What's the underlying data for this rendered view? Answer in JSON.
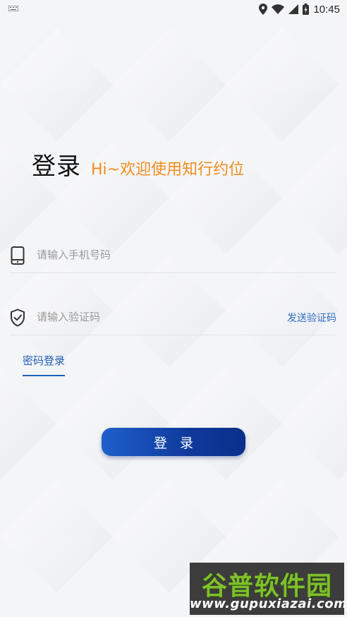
{
  "status_bar": {
    "time": "10:45",
    "icons": [
      "keyboard-icon",
      "location-icon",
      "wifi-icon",
      "signal-icon",
      "battery-icon"
    ]
  },
  "header": {
    "title": "登录",
    "greeting": "Hi~欢迎使用知行约位"
  },
  "form": {
    "phone": {
      "placeholder": "请输入手机号码",
      "value": "",
      "icon": "phone-icon"
    },
    "code": {
      "placeholder": "请输入验证码",
      "value": "",
      "icon": "shield-check-icon",
      "send_label": "发送验证码"
    },
    "password_login_label": "密码登录",
    "submit_label": "登录"
  },
  "watermark": {
    "brand": "谷普软件园",
    "url": "www.gupuxiazai.com"
  },
  "colors": {
    "accent_orange": "#f08c1c",
    "link_blue": "#2f6fc4",
    "button_start": "#1f5fcc",
    "button_end": "#0a2e8a",
    "background": "#f5f6f8"
  }
}
